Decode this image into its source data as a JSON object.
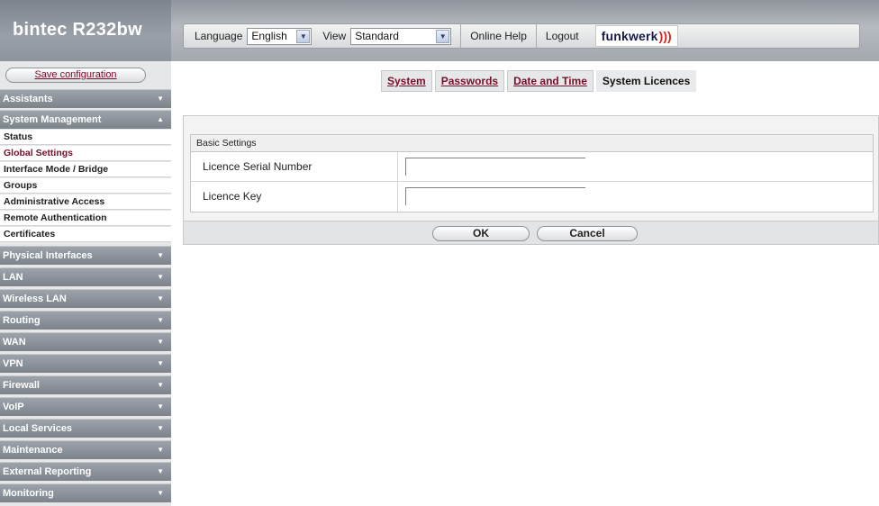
{
  "brand": {
    "title": "bintec  R232bw"
  },
  "toolbar": {
    "language_label": "Language",
    "language_value": "English",
    "view_label": "View",
    "view_value": "Standard",
    "online_help": "Online Help",
    "logout": "Logout",
    "logo_text": "funkwerk",
    "logo_mark": ")))"
  },
  "sidebar": {
    "save_label": "Save configuration",
    "menus": [
      {
        "label": "Assistants"
      },
      {
        "label": "System Management"
      },
      {
        "label": "Physical Interfaces"
      },
      {
        "label": "LAN"
      },
      {
        "label": "Wireless LAN"
      },
      {
        "label": "Routing"
      },
      {
        "label": "WAN"
      },
      {
        "label": "VPN"
      },
      {
        "label": "Firewall"
      },
      {
        "label": "VoIP"
      },
      {
        "label": "Local Services"
      },
      {
        "label": "Maintenance"
      },
      {
        "label": "External Reporting"
      },
      {
        "label": "Monitoring"
      }
    ],
    "submenu": [
      {
        "label": "Status"
      },
      {
        "label": "Global Settings"
      },
      {
        "label": "Interface Mode / Bridge"
      },
      {
        "label": "Groups"
      },
      {
        "label": "Administrative Access"
      },
      {
        "label": "Remote Authentication"
      },
      {
        "label": "Certificates"
      }
    ]
  },
  "tabs": [
    {
      "label": "System"
    },
    {
      "label": "Passwords"
    },
    {
      "label": "Date and Time"
    },
    {
      "label": "System Licences"
    }
  ],
  "form": {
    "section_title": "Basic Settings",
    "fields": [
      {
        "label": "Licence Serial Number",
        "value": ""
      },
      {
        "label": "Licence Key",
        "value": ""
      }
    ],
    "ok_label": "OK",
    "cancel_label": "Cancel"
  },
  "colors": {
    "link": "#7a0f2a",
    "menu_bg": "#8a9098",
    "accent_red": "#d7261e"
  }
}
